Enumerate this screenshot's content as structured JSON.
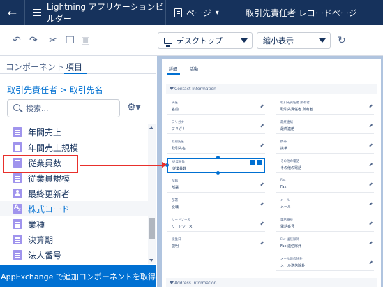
{
  "header": {
    "app_title": "Lightning アプリケーションビルダー",
    "pages_label": "ページ",
    "page_name": "取引先責任者 レコードページ"
  },
  "toolbar": {
    "device_select": "デスクトップ",
    "view_select": "縮小表示"
  },
  "left_panel": {
    "tabs": [
      "コンポーネント",
      "項目"
    ],
    "breadcrumb": "取引先責任者 > 取引先名",
    "search_placeholder": "検索...",
    "fields": [
      {
        "label": "年間売上",
        "icon": "list"
      },
      {
        "label": "年間売上規模",
        "icon": "list"
      },
      {
        "label": "従業員数",
        "icon": "box"
      },
      {
        "label": "従業員規模",
        "icon": "list"
      },
      {
        "label": "最終更新者",
        "icon": "user"
      },
      {
        "label": "株式コード",
        "icon": "az"
      },
      {
        "label": "業種",
        "icon": "list"
      },
      {
        "label": "決算期",
        "icon": "list"
      },
      {
        "label": "法人番号",
        "icon": "list"
      }
    ],
    "appexchange_label": "AppExchange で追加コンポーネントを取得"
  },
  "canvas": {
    "tabs": [
      "詳細",
      "活動"
    ],
    "section_contact": "Contact Information",
    "section_address": "Address Information",
    "left_fields": [
      {
        "label": "氏名",
        "value": "名前"
      },
      {
        "label": "フリガナ",
        "value": "フリガナ"
      },
      {
        "label": "取引先名",
        "value": "取引先名"
      },
      {
        "label": "従業員数",
        "value": "従業員数"
      },
      {
        "label": "役職",
        "value": "部署"
      },
      {
        "label": "部署",
        "value": "役職"
      },
      {
        "label": "リードソース",
        "value": "リードソース"
      },
      {
        "label": "誕生日",
        "value": "説明"
      }
    ],
    "right_fields": [
      {
        "label": "取引先責任者 所有者",
        "value": "取引先責任者 所有者"
      },
      {
        "label": "最終連絡",
        "value": "最終連絡"
      },
      {
        "label": "携帯",
        "value": "携帯"
      },
      {
        "label": "その他の電話",
        "value": "その他の電話"
      },
      {
        "label": "Fax",
        "value": "Fax"
      },
      {
        "label": "メール",
        "value": "メール"
      },
      {
        "label": "電話番号",
        "value": "電話番号"
      },
      {
        "label": "Fax 送信除外",
        "value": "Fax 送信除外"
      },
      {
        "label": "メール送信除外",
        "value": "メール送信除外"
      }
    ]
  }
}
